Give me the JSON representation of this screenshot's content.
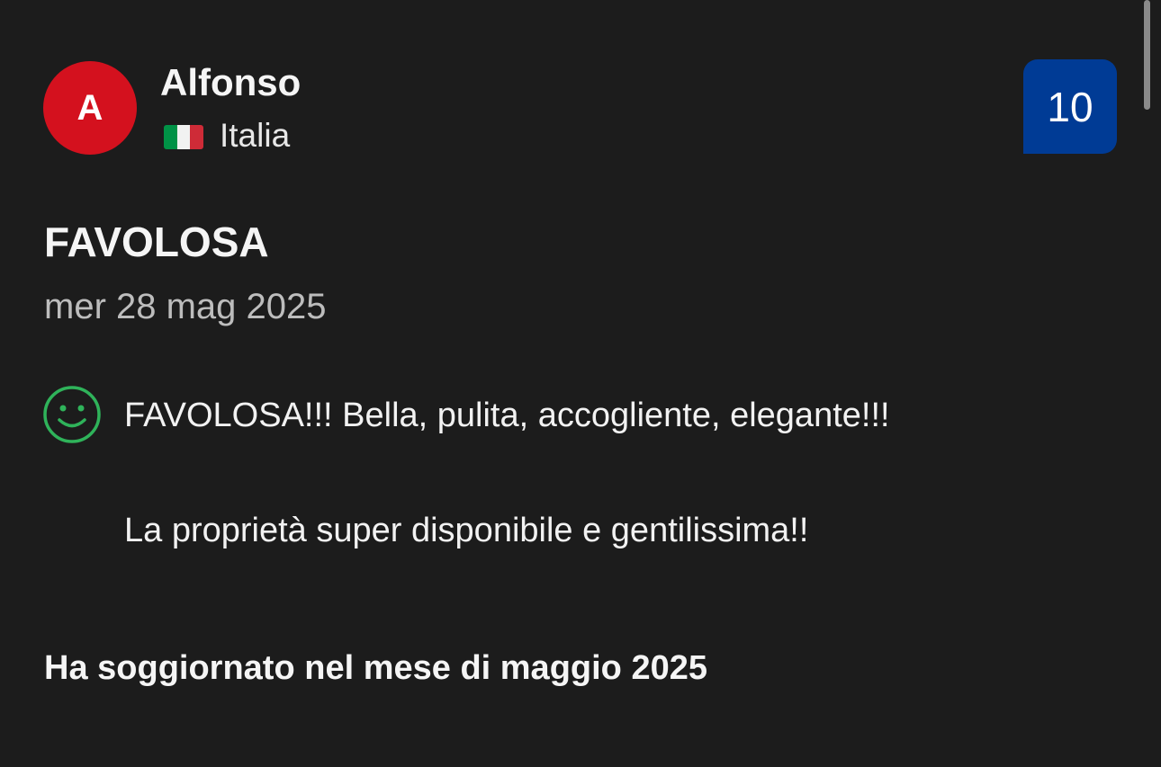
{
  "reviewer": {
    "initial": "A",
    "name": "Alfonso",
    "country": "Italia",
    "flag_icon": "italy-flag-icon",
    "avatar_color": "#d4111e"
  },
  "score": {
    "value": "10",
    "color": "#003b95"
  },
  "review": {
    "title": "FAVOLOSA",
    "date": "mer 28 mag 2025",
    "sentiment_icon": "smiley-face-icon",
    "sentiment_color": "#2fb35a",
    "positive_lines": [
      "FAVOLOSA!!! Bella, pulita, accogliente, elegante!!!",
      "La proprietà super disponibile e gentilissima!!"
    ]
  },
  "stay": {
    "text": "Ha soggiornato nel mese di maggio 2025"
  }
}
